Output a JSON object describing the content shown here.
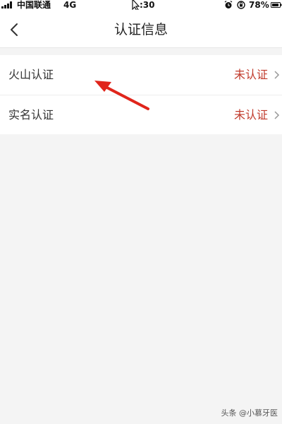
{
  "status_bar": {
    "carrier": "中国联通",
    "network": "4G",
    "time": ":30",
    "battery": "78%"
  },
  "nav": {
    "title": "认证信息"
  },
  "items": [
    {
      "label": "火山认证",
      "status": "未认证"
    },
    {
      "label": "实名认证",
      "status": "未认证"
    }
  ],
  "watermark": "头条 @小慕牙医",
  "colors": {
    "status_text": "#c0392b",
    "arrow": "#e0251b",
    "background": "#f4f4f4"
  }
}
